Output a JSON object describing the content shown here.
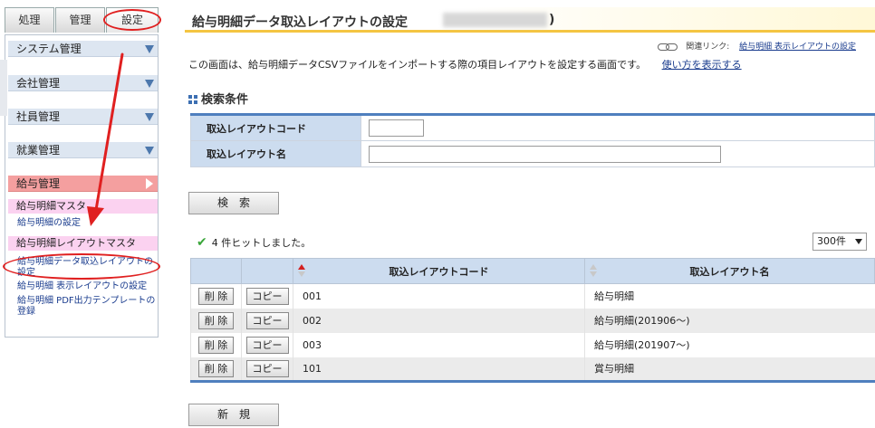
{
  "sidebar": {
    "tabs": [
      {
        "label": "処理"
      },
      {
        "label": "管理"
      },
      {
        "label": "設定"
      }
    ],
    "menus": [
      {
        "label": "システム管理"
      },
      {
        "label": "会社管理"
      },
      {
        "label": "社員管理"
      },
      {
        "label": "就業管理"
      },
      {
        "label": "給与管理"
      }
    ],
    "sub_headers": [
      {
        "label": "給与明細マスタ"
      },
      {
        "label": "給与明細レイアウトマスタ"
      }
    ],
    "links": [
      {
        "label": "給与明細の設定"
      },
      {
        "label": "給与明細データ取込レイアウトの設定"
      },
      {
        "label": "給与明細 表示レイアウトの設定"
      },
      {
        "label": "給与明細 PDF出力テンプレートの登録"
      }
    ]
  },
  "page": {
    "title": "給与明細データ取込レイアウトの設定",
    "title_suffix": ")",
    "related_label": "関連リンク:",
    "related_link": "給与明細 表示レイアウトの設定",
    "description": "この画面は、給与明細データCSVファイルをインポートする際の項目レイアウトを設定する画面です。",
    "howto_link": "使い方を表示する"
  },
  "search": {
    "section_title": "検索条件",
    "code_label": "取込レイアウトコード",
    "name_label": "取込レイアウト名",
    "code_value": "",
    "name_value": "",
    "search_button": "検　索"
  },
  "results": {
    "hits_text": "4 件ヒットしました。",
    "per_page": "300件",
    "columns": {
      "code": "取込レイアウトコード",
      "name": "取込レイアウト名"
    },
    "delete_label": "削 除",
    "copy_label": "コピー",
    "rows": [
      {
        "code": "001",
        "name": "給与明細"
      },
      {
        "code": "002",
        "name": "給与明細(201906～)"
      },
      {
        "code": "003",
        "name": "給与明細(201907～)"
      },
      {
        "code": "101",
        "name": "賞与明細"
      }
    ],
    "new_button": "新　規"
  },
  "colors": {
    "accent_blue": "#4f7fbe",
    "header_blue": "#ccdcef",
    "title_underline": "#f4c542",
    "annotation_red": "#e02020",
    "active_menu": "#f49f9f",
    "sub_header_pink": "#fbd2f0"
  }
}
